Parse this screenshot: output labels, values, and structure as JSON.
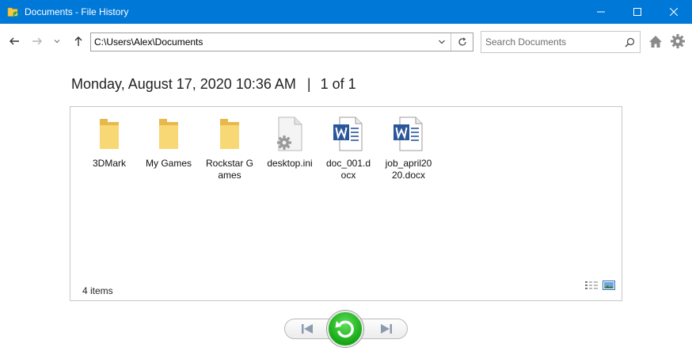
{
  "window": {
    "title": "Documents - File History"
  },
  "nav": {
    "address": "C:\\Users\\Alex\\Documents",
    "search_placeholder": "Search Documents"
  },
  "header": {
    "date": "Monday, August 17, 2020 10:36 AM",
    "separator": "|",
    "page_info": "1 of 1"
  },
  "files": [
    {
      "name": "3DMark",
      "type": "folder"
    },
    {
      "name": "My Games",
      "type": "folder"
    },
    {
      "name": "Rockstar Games",
      "type": "folder"
    },
    {
      "name": "desktop.ini",
      "type": "settings-file"
    },
    {
      "name": "doc_001.docx",
      "type": "word-document"
    },
    {
      "name": "job_april2020.docx",
      "type": "word-document"
    }
  ],
  "status": {
    "items_count": "4 items"
  },
  "colors": {
    "titlebar": "#0078d7",
    "folder": "#f8d775",
    "word": "#2b579a",
    "restore": "#1fb41c"
  }
}
